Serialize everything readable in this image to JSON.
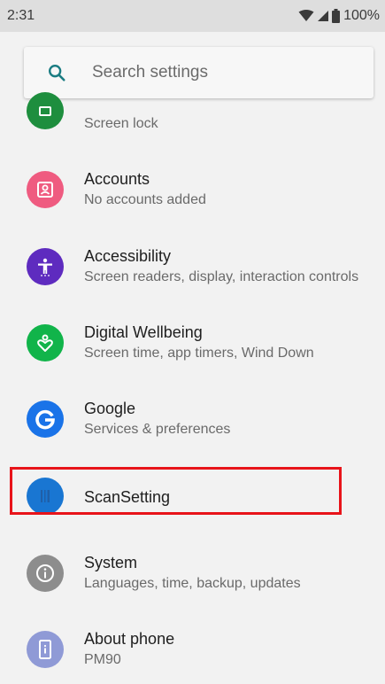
{
  "status_bar": {
    "time": "2:31",
    "battery": "100%"
  },
  "search": {
    "placeholder": "Search settings"
  },
  "items": [
    {
      "title": "",
      "subtitle": "Screen lock",
      "icon": "lock-icon",
      "color": "#1e8e3e"
    },
    {
      "title": "Accounts",
      "subtitle": "No accounts added",
      "icon": "account-box-icon",
      "color": "#ef5b80"
    },
    {
      "title": "Accessibility",
      "subtitle": "Screen readers, display, interaction controls",
      "icon": "accessibility-icon",
      "color": "#5e2bbf"
    },
    {
      "title": "Digital Wellbeing",
      "subtitle": "Screen time, app timers, Wind Down",
      "icon": "heart-person-icon",
      "color": "#11b44a"
    },
    {
      "title": "Google",
      "subtitle": "Services & preferences",
      "icon": "google-g-icon",
      "color": "#1a73e8"
    },
    {
      "title": "ScanSetting",
      "subtitle": "",
      "icon": "scan-icon",
      "color": "#1976d2"
    },
    {
      "title": "System",
      "subtitle": "Languages, time, backup, updates",
      "icon": "info-icon",
      "color": "#8d8d8d"
    },
    {
      "title": "About phone",
      "subtitle": "PM90",
      "icon": "phone-info-icon",
      "color": "#8f9ad6"
    }
  ],
  "highlight_color": "#e8141a"
}
